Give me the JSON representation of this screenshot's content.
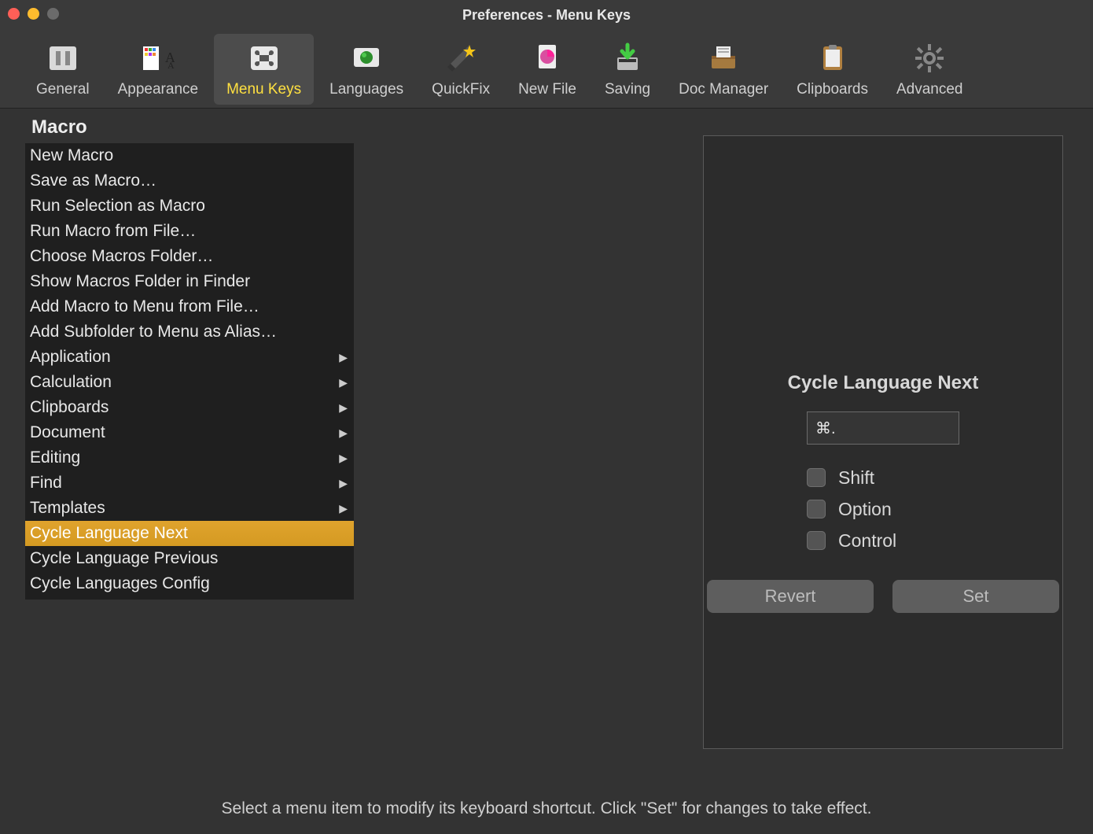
{
  "window": {
    "title": "Preferences - Menu Keys"
  },
  "toolbar": {
    "items": [
      {
        "id": "general",
        "label": "General"
      },
      {
        "id": "appearance",
        "label": "Appearance"
      },
      {
        "id": "menukeys",
        "label": "Menu Keys",
        "active": true
      },
      {
        "id": "languages",
        "label": "Languages"
      },
      {
        "id": "quickfix",
        "label": "QuickFix"
      },
      {
        "id": "newfile",
        "label": "New File"
      },
      {
        "id": "saving",
        "label": "Saving"
      },
      {
        "id": "docmanager",
        "label": "Doc Manager"
      },
      {
        "id": "clipboards",
        "label": "Clipboards"
      },
      {
        "id": "advanced",
        "label": "Advanced"
      }
    ]
  },
  "menu": {
    "header": "Macro",
    "items": [
      {
        "label": "New Macro",
        "submenu": false
      },
      {
        "label": "Save as Macro…",
        "submenu": false
      },
      {
        "label": "Run Selection as Macro",
        "submenu": false
      },
      {
        "label": "Run Macro from File…",
        "submenu": false
      },
      {
        "label": "Choose Macros Folder…",
        "submenu": false
      },
      {
        "label": "Show Macros Folder in Finder",
        "submenu": false
      },
      {
        "label": "Add Macro to Menu from File…",
        "submenu": false
      },
      {
        "label": "Add Subfolder to Menu as Alias…",
        "submenu": false
      },
      {
        "label": "Application",
        "submenu": true
      },
      {
        "label": "Calculation",
        "submenu": true
      },
      {
        "label": "Clipboards",
        "submenu": true
      },
      {
        "label": "Document",
        "submenu": true
      },
      {
        "label": "Editing",
        "submenu": true
      },
      {
        "label": "Find",
        "submenu": true
      },
      {
        "label": "Templates",
        "submenu": true
      },
      {
        "label": "Cycle Language Next",
        "submenu": false,
        "selected": true
      },
      {
        "label": "Cycle Language Previous",
        "submenu": false
      },
      {
        "label": "Cycle Languages Config",
        "submenu": false
      }
    ]
  },
  "detail": {
    "title": "Cycle Language Next",
    "shortcut_value": "⌘.",
    "modifiers": {
      "shift_label": "Shift",
      "option_label": "Option",
      "control_label": "Control"
    },
    "revert_label": "Revert",
    "set_label": "Set"
  },
  "footer": {
    "hint": "Select a menu item to modify its keyboard shortcut.  Click \"Set\" for changes to take effect."
  }
}
